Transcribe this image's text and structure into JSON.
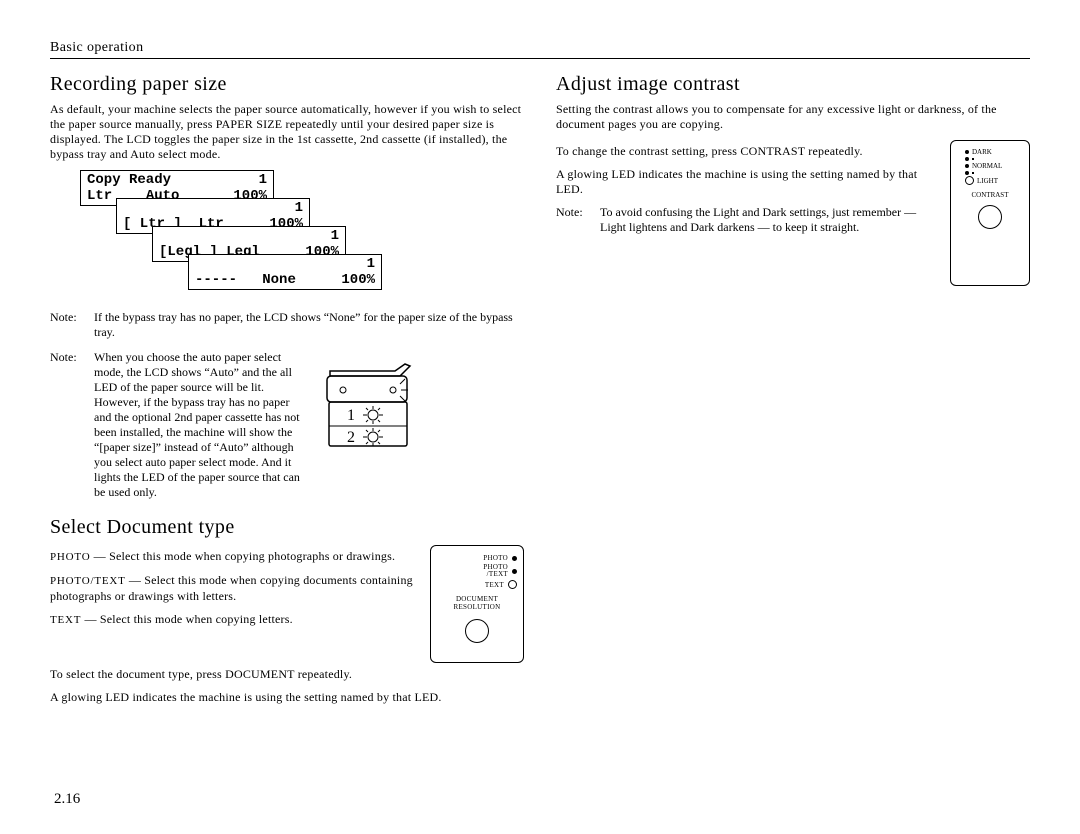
{
  "header": "Basic operation",
  "page_number": "2.16",
  "left": {
    "h_recording": "Recording paper size",
    "p_recording": "As default, your machine selects the paper source automatically, however if you wish to select the paper source manually, press PAPER SIZE repeatedly until your desired paper size is displayed. The LCD toggles the paper size in the 1st cassette, 2nd cassette (if installed), the bypass tray and Auto select mode.",
    "lcd": [
      {
        "l1a": "Copy Ready",
        "l1b": "1",
        "l2a": "Ltr",
        "l2b": "Auto",
        "l2c": "100%"
      },
      {
        "l1b": "1",
        "l2a": "[ Ltr ]",
        "l2b": "Ltr",
        "l2c": "100%"
      },
      {
        "l1b": "1",
        "l2a": "[Legl ]",
        "l2b": "Legl",
        "l2c": "100%"
      },
      {
        "l1b": "1",
        "l2a": "-----",
        "l2b": "None",
        "l2c": "100%"
      }
    ],
    "note1_label": "Note:",
    "note1": "If the bypass tray has no paper, the LCD shows “None” for the paper size of the bypass tray.",
    "note2_label": "Note:",
    "note2a": "When you choose the auto paper select mode, the LCD shows “Auto” and the all LED of the paper source will be lit.",
    "note2b": "However, if the bypass tray has no paper and the optional 2nd paper cassette has not been installed, the machine will show the “[paper size]” instead of “Auto” although you select auto paper select mode. And it lights the LED of the paper source that can be used only.",
    "h_doctype": "Select Document type",
    "doc_photo_lbl": "PHOTO",
    "doc_photo": " — Select this mode when copying photographs or drawings.",
    "doc_pt_lbl": "PHOTO/TEXT",
    "doc_pt": " — Select this mode when copying documents containing photographs or drawings with letters.",
    "doc_text_lbl": "TEXT",
    "doc_text": " — Select this mode when copying letters.",
    "doc_select": "To select the document type, press DOCUMENT repeatedly.",
    "doc_glow": "A glowing LED indicates the machine is using the setting named by that LED.",
    "doc_panel": {
      "photo": "PHOTO",
      "phototext": "PHOTO\n/TEXT",
      "text": "TEXT",
      "caption": "DOCUMENT\nRESOLUTION"
    }
  },
  "right": {
    "h_contrast": "Adjust image contrast",
    "p_contrast": "Setting the contrast allows you to compensate for any excessive light or darkness, of the document pages you are copying.",
    "p_change": "To change the contrast setting, press CONTRAST repeatedly.",
    "p_glow": "A glowing LED indicates the machine is using the setting named by that LED.",
    "note_label": "Note:",
    "note": "To avoid confusing the Light and Dark settings, just remember — Light lightens and Dark darkens — to keep it straight.",
    "panel": {
      "dark": "DARK",
      "normal": "NORMAL",
      "light": "LIGHT",
      "caption": "CONTRAST"
    }
  }
}
